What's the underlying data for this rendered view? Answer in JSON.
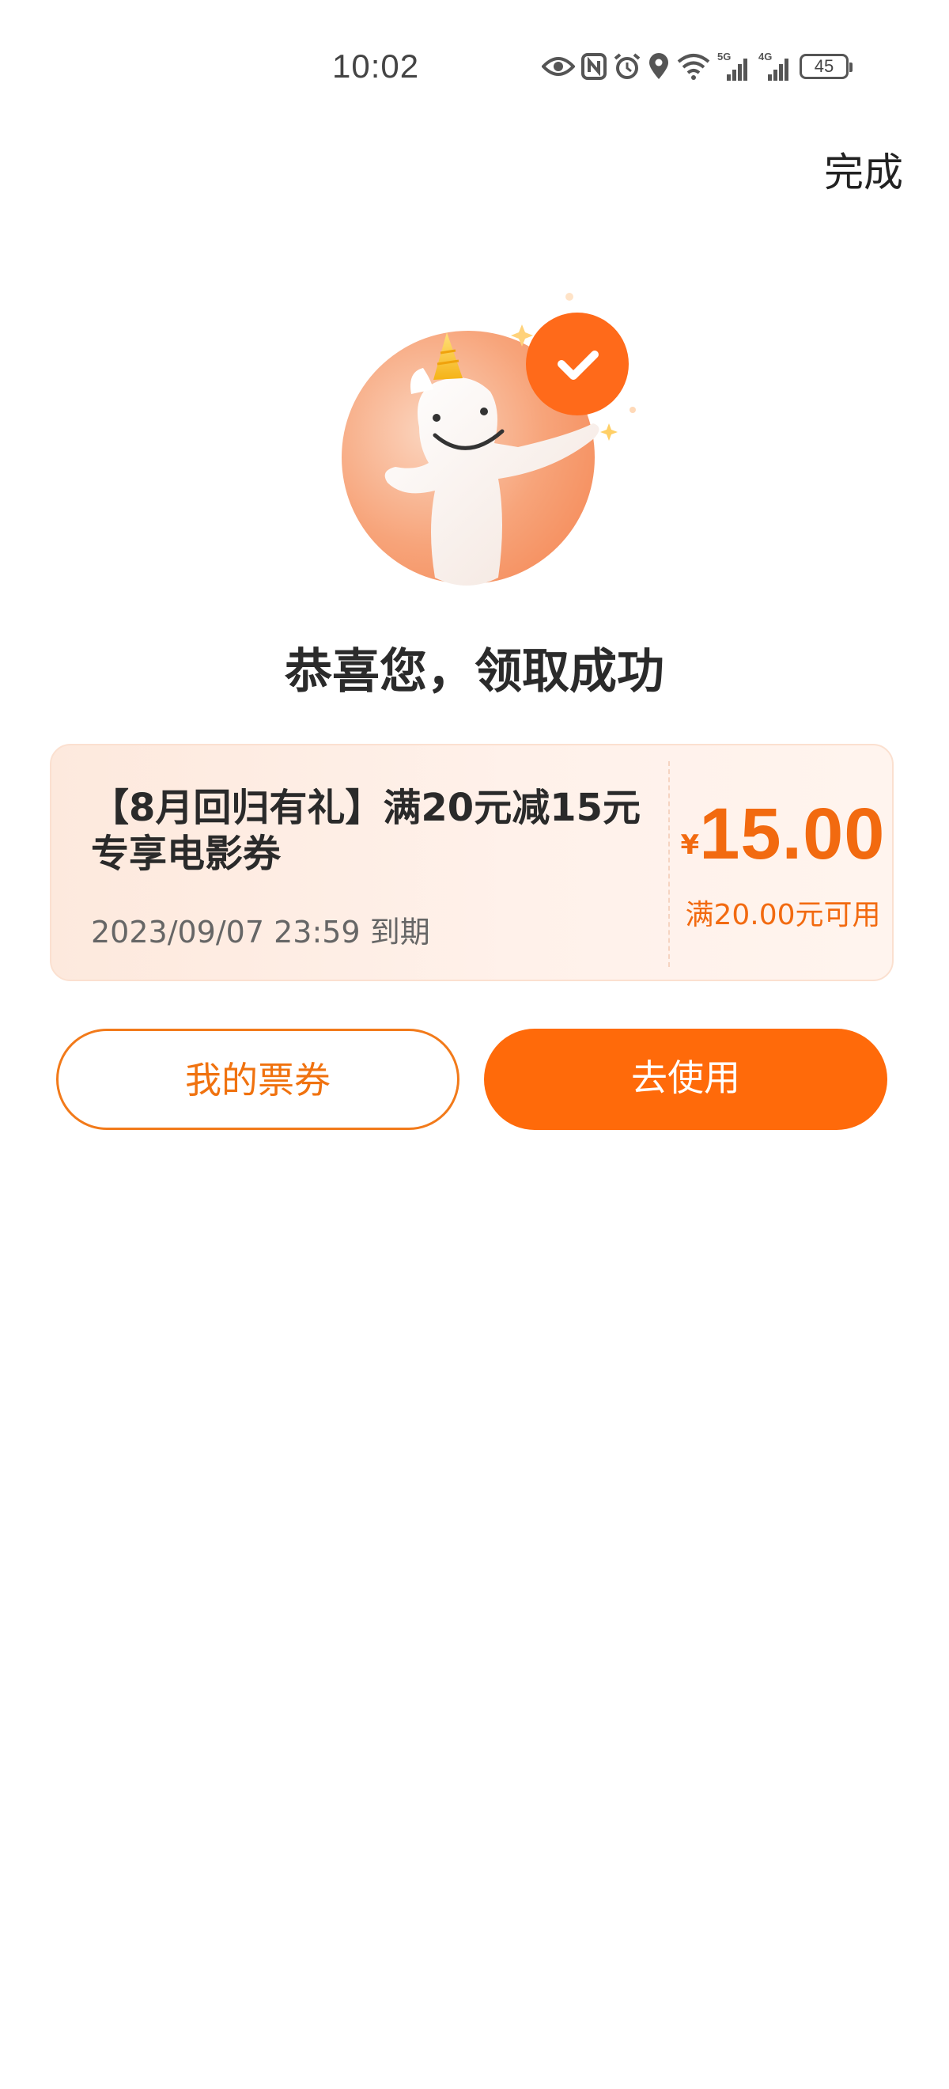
{
  "status_bar": {
    "time": "10:02",
    "signal1_label": "5G",
    "signal2_label": "4G",
    "battery": "45"
  },
  "header": {
    "done_label": "完成"
  },
  "success": {
    "title": "恭喜您，领取成功"
  },
  "coupon": {
    "title": "【8月回归有礼】满20元减15元专享电影券",
    "expire": "2023/09/07 23:59 到期",
    "currency": "¥",
    "amount": "15.00",
    "condition": "满20.00元可用"
  },
  "actions": {
    "my_tickets_label": "我的票券",
    "use_label": "去使用"
  },
  "colors": {
    "accent": "#ff6a0a",
    "coupon_bg": "#fdebe0"
  }
}
